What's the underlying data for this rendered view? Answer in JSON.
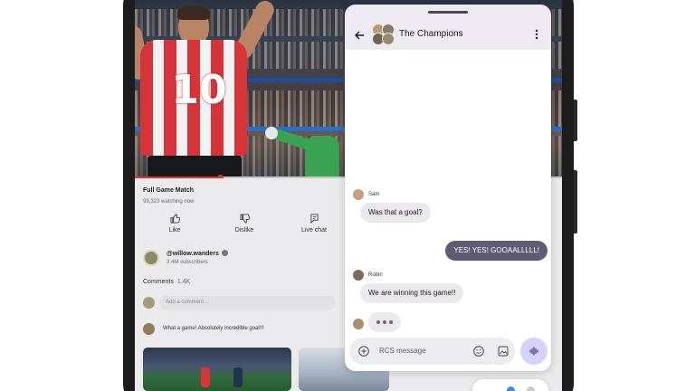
{
  "video": {
    "jersey_number": "10",
    "progress_fraction": 0.2,
    "title": "Full Game Match",
    "views": "99,323 watching now"
  },
  "actions": [
    {
      "label": "Like",
      "icon": "thumbs-up-icon"
    },
    {
      "label": "Dislike",
      "icon": "thumbs-down-icon"
    },
    {
      "label": "Live chat",
      "icon": "chat-icon"
    }
  ],
  "channel": {
    "name": "@willow.wanders",
    "subscribers": "3.4M subscribers"
  },
  "comments": {
    "label": "Comments",
    "count": "1.4K",
    "placeholder": "Add a comment...",
    "top_comment": "What a game! Absolutely incredible goal!!!"
  },
  "chat": {
    "title": "The Champions",
    "messages": [
      {
        "sender": "Sam",
        "text": "Was that a goal?",
        "direction": "in"
      },
      {
        "sender": "",
        "text": "YES! YES! GOOAALLLLL!",
        "direction": "out"
      },
      {
        "sender": "Robin",
        "text": "We are winning this game!!",
        "direction": "in"
      }
    ],
    "compose_placeholder": "RCS message",
    "icons": [
      "back-arrow-icon",
      "more-vert-icon",
      "add-icon",
      "emoji-icon",
      "image-icon",
      "voice-icon"
    ]
  },
  "colors": {
    "accent": "#5e5b73",
    "mic_bg": "#d6d2ff",
    "progress": "#e0352b",
    "header_bg": "#edeaf2"
  }
}
